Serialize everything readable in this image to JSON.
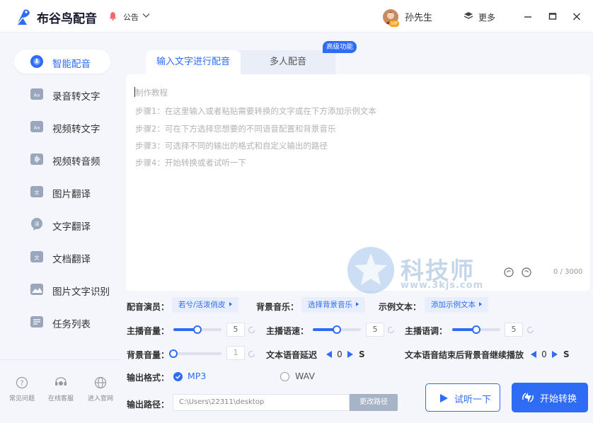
{
  "app": {
    "title": "布谷鸟配音",
    "notice": "公告",
    "username": "孙先生",
    "vip_badge": "VIP",
    "more": "更多"
  },
  "colors": {
    "accent": "#2e6cf6",
    "sidebar_bg": "#f4f6fb",
    "chip_bg": "#e8eefc"
  },
  "sidebar": {
    "items": [
      {
        "label": "智能配音",
        "icon": "smart-dub-icon",
        "active": true
      },
      {
        "label": "录音转文字",
        "icon": "record-to-text-icon"
      },
      {
        "label": "视频转文字",
        "icon": "video-to-text-icon"
      },
      {
        "label": "视频转音频",
        "icon": "video-to-audio-icon"
      },
      {
        "label": "图片翻译",
        "icon": "image-translate-icon"
      },
      {
        "label": "文字翻译",
        "icon": "text-translate-icon"
      },
      {
        "label": "文档翻译",
        "icon": "doc-translate-icon"
      },
      {
        "label": "图片文字识别",
        "icon": "image-ocr-icon"
      },
      {
        "label": "任务列表",
        "icon": "task-list-icon"
      }
    ],
    "footer": [
      {
        "label": "常见问题",
        "icon": "help-icon"
      },
      {
        "label": "在线客服",
        "icon": "service-icon"
      },
      {
        "label": "进入官网",
        "icon": "website-icon"
      }
    ]
  },
  "tabs": [
    {
      "label": "输入文字进行配音",
      "active": true
    },
    {
      "label": "多人配音"
    }
  ],
  "advanced_badge": "高级功能",
  "editor": {
    "lines": [
      "制作教程",
      "步骤1：在这里输入或者粘贴需要转换的文字或在下方添加示例文本",
      "步骤2：可在下方选择您想要的不同语音配置和背景音乐",
      "步骤3：可选择不同的输出的格式和自定义输出的路径",
      "步骤4：开始转换或者试听一下"
    ],
    "counter": "0 / 3000"
  },
  "watermark": {
    "text": "科技师",
    "url": "www.3kjs.com"
  },
  "settings": {
    "voice": {
      "label": "配音演员：",
      "value": "若兮/活泼俏皮"
    },
    "bgm": {
      "label": "背景音乐：",
      "value": "选择背景音乐"
    },
    "sample": {
      "label": "示例文本：",
      "value": "添加示例文本"
    },
    "main_volume": {
      "label": "主播音量：",
      "value": "5",
      "fraction": 0.5
    },
    "speed": {
      "label": "主播语速：",
      "value": "5",
      "fraction": 0.5
    },
    "pitch": {
      "label": "主播语调：",
      "value": "5",
      "fraction": 0.5
    },
    "bg_volume": {
      "label": "背景音量：",
      "value": "1",
      "fraction": 0.0
    },
    "delay": {
      "label": "文本语音延迟",
      "value": "0",
      "unit": "S"
    },
    "bg_continue": {
      "label": "文本语音结束后背景音继续播放",
      "value": "0",
      "unit": "S"
    },
    "format": {
      "label": "输出格式：",
      "options": [
        "MP3",
        "WAV"
      ],
      "selected": "MP3"
    },
    "path": {
      "label": "输出路径：",
      "value": "C:\\Users\\22311\\desktop",
      "button": "更改路径"
    }
  },
  "actions": {
    "listen": "试听一下",
    "start": "开始转换"
  }
}
